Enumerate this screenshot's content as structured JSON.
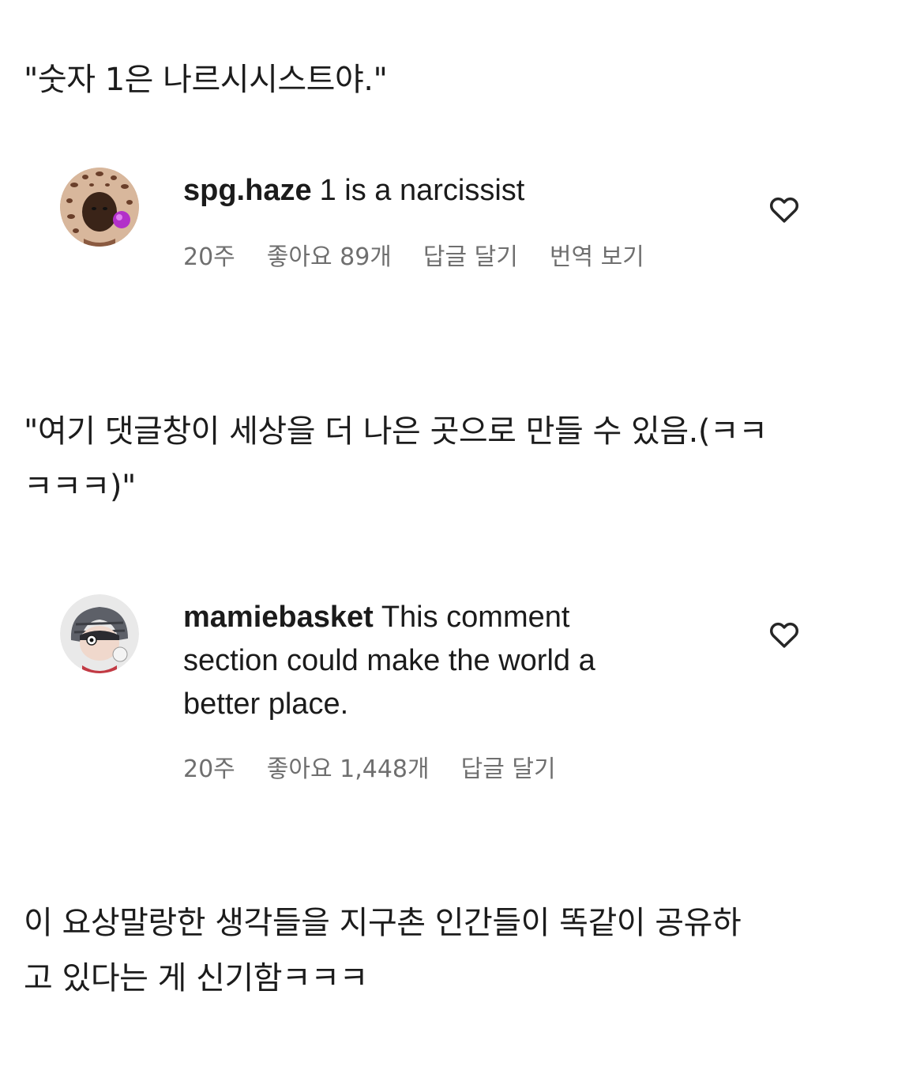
{
  "captions": {
    "first": "\"숫자 1은 나르시시스트야.\"",
    "second_line1": "\"여기 댓글창이 세상을 더 나은 곳으로 만들 수 있음.(ㅋㅋ",
    "second_line2": "ㅋㅋㅋ)\"",
    "third_line1": "이 요상말랑한 생각들을 지구촌 인간들이 똑같이 공유하",
    "third_line2": "고 있다는 게 신기함ㅋㅋㅋ"
  },
  "comments": [
    {
      "username": "spg.haze",
      "text": "1 is a narcissist",
      "time": "20주",
      "likes": "좋아요 89개",
      "reply": "답글 달기",
      "translate": "번역 보기",
      "avatar_icon": "leopard-hood-avatar",
      "like_icon": "heart-outline-icon"
    },
    {
      "username": "mamiebasket",
      "text_line1": "This comment",
      "text_line2": "section could make the world a",
      "text_line3": "better place.",
      "time": "20주",
      "likes": "좋아요 1,448개",
      "reply": "답글 달기",
      "avatar_icon": "cartoon-character-avatar",
      "like_icon": "heart-outline-icon"
    }
  ],
  "colors": {
    "text": "#1b1b1b",
    "meta": "#6f6f6f",
    "background": "#ffffff"
  }
}
